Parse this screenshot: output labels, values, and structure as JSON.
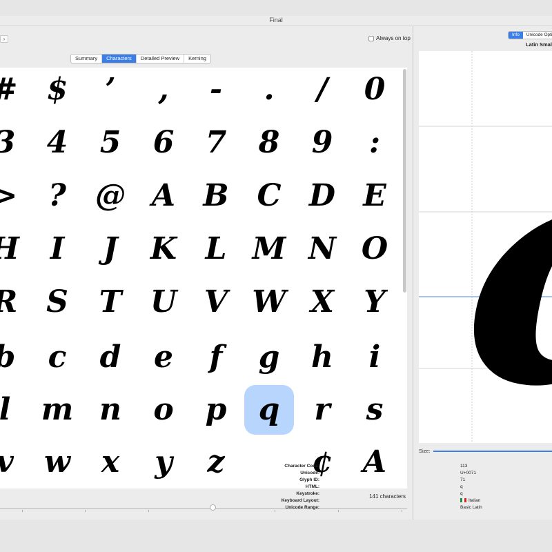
{
  "window": {
    "title": "Final"
  },
  "toolbar": {
    "nav_glyph": "›",
    "always_on_top": "Always on top"
  },
  "view_tabs": [
    {
      "label": "Summary",
      "active": false
    },
    {
      "label": "Characters",
      "active": true
    },
    {
      "label": "Detailed Preview",
      "active": false
    },
    {
      "label": "Kerning",
      "active": false
    }
  ],
  "glyph_grid": [
    "#",
    "$",
    "’",
    ",",
    "-",
    ".",
    "/",
    "0",
    "3",
    "4",
    "5",
    "6",
    "7",
    "8",
    "9",
    ":",
    ">",
    "?",
    "@",
    "A",
    "B",
    "C",
    "D",
    "E",
    "H",
    "I",
    "J",
    "K",
    "L",
    "M",
    "N",
    "O",
    "R",
    "S",
    "T",
    "U",
    "V",
    "W",
    "X",
    "Y",
    "b",
    "c",
    "d",
    "e",
    "f",
    "g",
    "h",
    "i",
    "l",
    "m",
    "n",
    "o",
    "p",
    "q",
    "r",
    "s",
    "v",
    "w",
    "x",
    "y",
    "z",
    "",
    "¢",
    "A"
  ],
  "selected_glyph": "q",
  "status": {
    "count": "141 characters"
  },
  "info_panel": {
    "tabs": [
      {
        "label": "Info",
        "active": true
      },
      {
        "label": "Unicode Opti",
        "active": false
      }
    ],
    "glyph_name": "Latin Small",
    "preview_glyph": "q",
    "size_label": "Size:",
    "fields": [
      {
        "key": "Character Code:",
        "value": "113"
      },
      {
        "key": "Unicode:",
        "value": "U+0071"
      },
      {
        "key": "Glyph ID:",
        "value": "71"
      },
      {
        "key": "HTML:",
        "value": "q"
      },
      {
        "key": "Keystroke:",
        "value": "q"
      },
      {
        "key": "Keyboard Layout:",
        "value": "Italian",
        "flag": true
      },
      {
        "key": "Unicode Range:",
        "value": "Basic Latin"
      }
    ]
  },
  "colors": {
    "accent": "#3b7ee6",
    "selection": "#b7d5fd"
  }
}
